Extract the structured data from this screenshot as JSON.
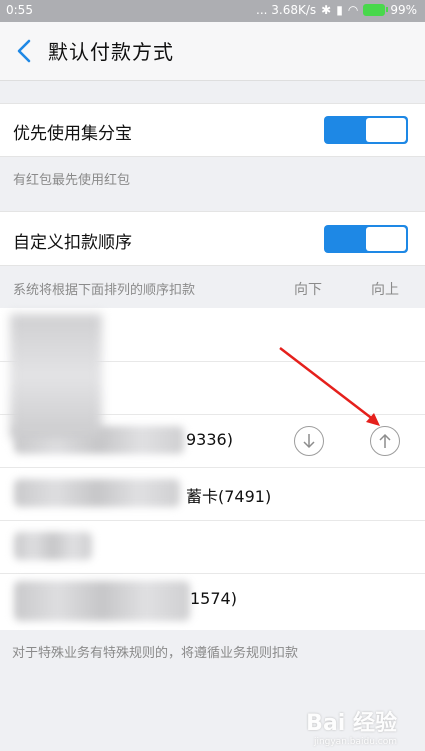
{
  "status_bar": {
    "time": "0:55",
    "network_speed": "... 3.68K/s",
    "battery": "99%"
  },
  "header": {
    "title": "默认付款方式"
  },
  "sections": {
    "jifenbao": {
      "label": "优先使用集分宝",
      "enabled": true,
      "hint": "有红包最先使用红包"
    },
    "custom_order": {
      "label": "自定义扣款顺序",
      "enabled": true,
      "hint": "系统将根据下面排列的顺序扣款"
    }
  },
  "columns": {
    "down": "向下",
    "up": "向上"
  },
  "payment_items": [
    {
      "suffix": ""
    },
    {
      "suffix": ""
    },
    {
      "suffix": "9336)"
    },
    {
      "suffix": "蓄卡(7491)"
    },
    {
      "suffix": ""
    },
    {
      "suffix": "1574)"
    }
  ],
  "footer_note": "对于特殊业务有特殊规则的，将遵循业务规则扣款",
  "watermark": {
    "main": "Bai 经验",
    "sub": "jingyan.baidu.com"
  },
  "colors": {
    "accent": "#1e88e5",
    "arrow": "#e5201c"
  }
}
